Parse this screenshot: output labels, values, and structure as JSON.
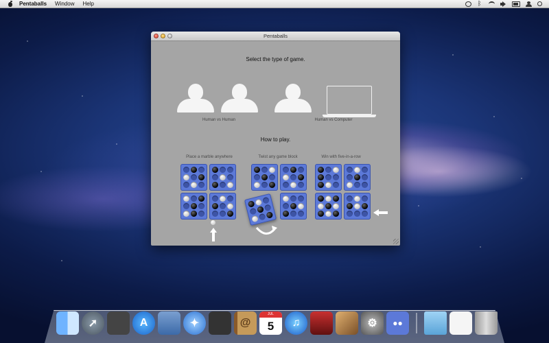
{
  "menubar": {
    "app_name": "Pentaballs",
    "menus": [
      "Window",
      "Help"
    ],
    "status_icons": [
      "clock-icon",
      "bluetooth-icon",
      "wifi-icon",
      "volume-icon",
      "battery-icon",
      "user-icon",
      "spotlight-icon"
    ]
  },
  "window": {
    "title": "Pentaballs",
    "select_heading": "Select the type of game.",
    "modes": [
      {
        "label": "Human vs Human",
        "icon": "two-person-silhouette-icon"
      },
      {
        "label": "Human vs Computer",
        "icon": "person-and-laptop-icon"
      }
    ],
    "howto_heading": "How to play.",
    "steps": [
      {
        "label": "Place a marble anywhere"
      },
      {
        "label": "Twist any game block"
      },
      {
        "label": "Win with five-in-a-row"
      }
    ]
  },
  "dock": {
    "items": [
      "Finder",
      "Launchpad",
      "Dashboard",
      "App Store",
      "Mail",
      "Safari",
      "FaceTime",
      "Contacts",
      "Calendar",
      "iTunes",
      "Photo Booth",
      "iPhoto",
      "System Preferences",
      "Pentaballs",
      "Documents",
      "Downloads",
      "Trash"
    ],
    "calendar_month": "JUL",
    "calendar_day": "5"
  },
  "colors": {
    "board_blue": "#5c79d8",
    "window_gray": "#a5a5a5"
  }
}
